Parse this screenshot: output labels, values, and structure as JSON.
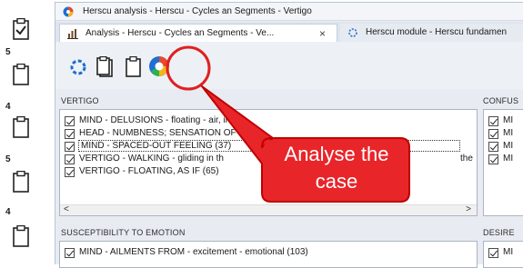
{
  "left_strip": {
    "numbers": [
      "5",
      "4",
      "5",
      "4"
    ]
  },
  "window": {
    "title": "Herscu analysis - Herscu - Cycles an Segments - Vertigo"
  },
  "tabs": [
    {
      "label": "Analysis - Herscu - Cycles an Segments - Ve...",
      "close": "×"
    },
    {
      "label": "Herscu module - Herscu fundamen"
    }
  ],
  "sections": {
    "vertigo": {
      "header": "VERTIGO",
      "rows": [
        "MIND - DELUSIONS - floating - air, in (",
        "HEAD - NUMBNESS; SENSATION OF (",
        "MIND - SPACED-OUT FEELING (37)",
        "VERTIGO - WALKING - gliding in th",
        "VERTIGO - FLOATING, AS IF (65)"
      ],
      "trailing_text": "the"
    },
    "confusion": {
      "header": "CONFUS",
      "rows": [
        "MI",
        "MI",
        "MI",
        "MI"
      ]
    },
    "susceptibility": {
      "header": "SUSCEPTIBILITY TO EMOTION",
      "rows": [
        "MIND - AILMENTS FROM - excitement - emotional (103)"
      ]
    },
    "desire": {
      "header": "DESIRE",
      "rows": [
        "MI"
      ]
    }
  },
  "scroll": {
    "left": "<",
    "right": ">"
  },
  "callout": {
    "line1": "Analyse the",
    "line2": "case"
  },
  "colors": {
    "callout_fill": "#e8262a",
    "callout_stroke": "#c00000",
    "highlight_ring": "#e02020"
  }
}
